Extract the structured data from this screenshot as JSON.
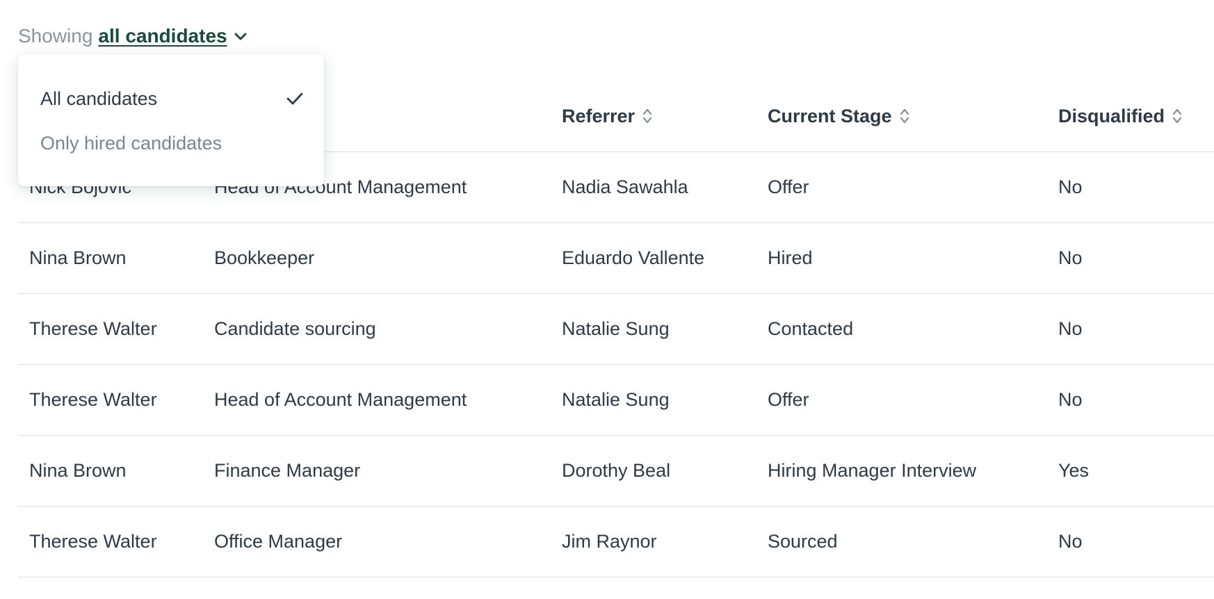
{
  "filter": {
    "prefix": "Showing",
    "value": "all candidates"
  },
  "dropdown": {
    "options": [
      {
        "label": "All candidates",
        "selected": true
      },
      {
        "label": "Only hired candidates",
        "selected": false
      }
    ]
  },
  "table": {
    "columns": [
      {
        "label": "",
        "sortable": false
      },
      {
        "label": "",
        "sortable": false
      },
      {
        "label": "Referrer",
        "sortable": true
      },
      {
        "label": "Current Stage",
        "sortable": true
      },
      {
        "label": "Disqualified",
        "sortable": true
      }
    ],
    "rows": [
      {
        "candidate": "Nick Bojovic",
        "job": "Head of Account Management",
        "referrer": "Nadia Sawahla",
        "stage": "Offer",
        "disqualified": "No"
      },
      {
        "candidate": "Nina Brown",
        "job": "Bookkeeper",
        "referrer": "Eduardo Vallente",
        "stage": "Hired",
        "disqualified": "No"
      },
      {
        "candidate": "Therese Walter",
        "job": "Candidate sourcing",
        "referrer": "Natalie Sung",
        "stage": "Contacted",
        "disqualified": "No"
      },
      {
        "candidate": "Therese Walter",
        "job": "Head of Account Management",
        "referrer": "Natalie Sung",
        "stage": "Offer",
        "disqualified": "No"
      },
      {
        "candidate": "Nina Brown",
        "job": "Finance Manager",
        "referrer": "Dorothy Beal",
        "stage": "Hiring Manager Interview",
        "disqualified": "Yes"
      },
      {
        "candidate": "Therese Walter",
        "job": "Office Manager",
        "referrer": "Jim Raynor",
        "stage": "Sourced",
        "disqualified": "No"
      }
    ]
  },
  "colors": {
    "link": "#1b4a3c",
    "text": "#2f3a44",
    "muted": "#8a949c",
    "border": "#dcdfe2"
  },
  "icons": {
    "filter_chevron": "chevron-down-icon",
    "sort": "sort-icon",
    "check": "check-icon"
  }
}
